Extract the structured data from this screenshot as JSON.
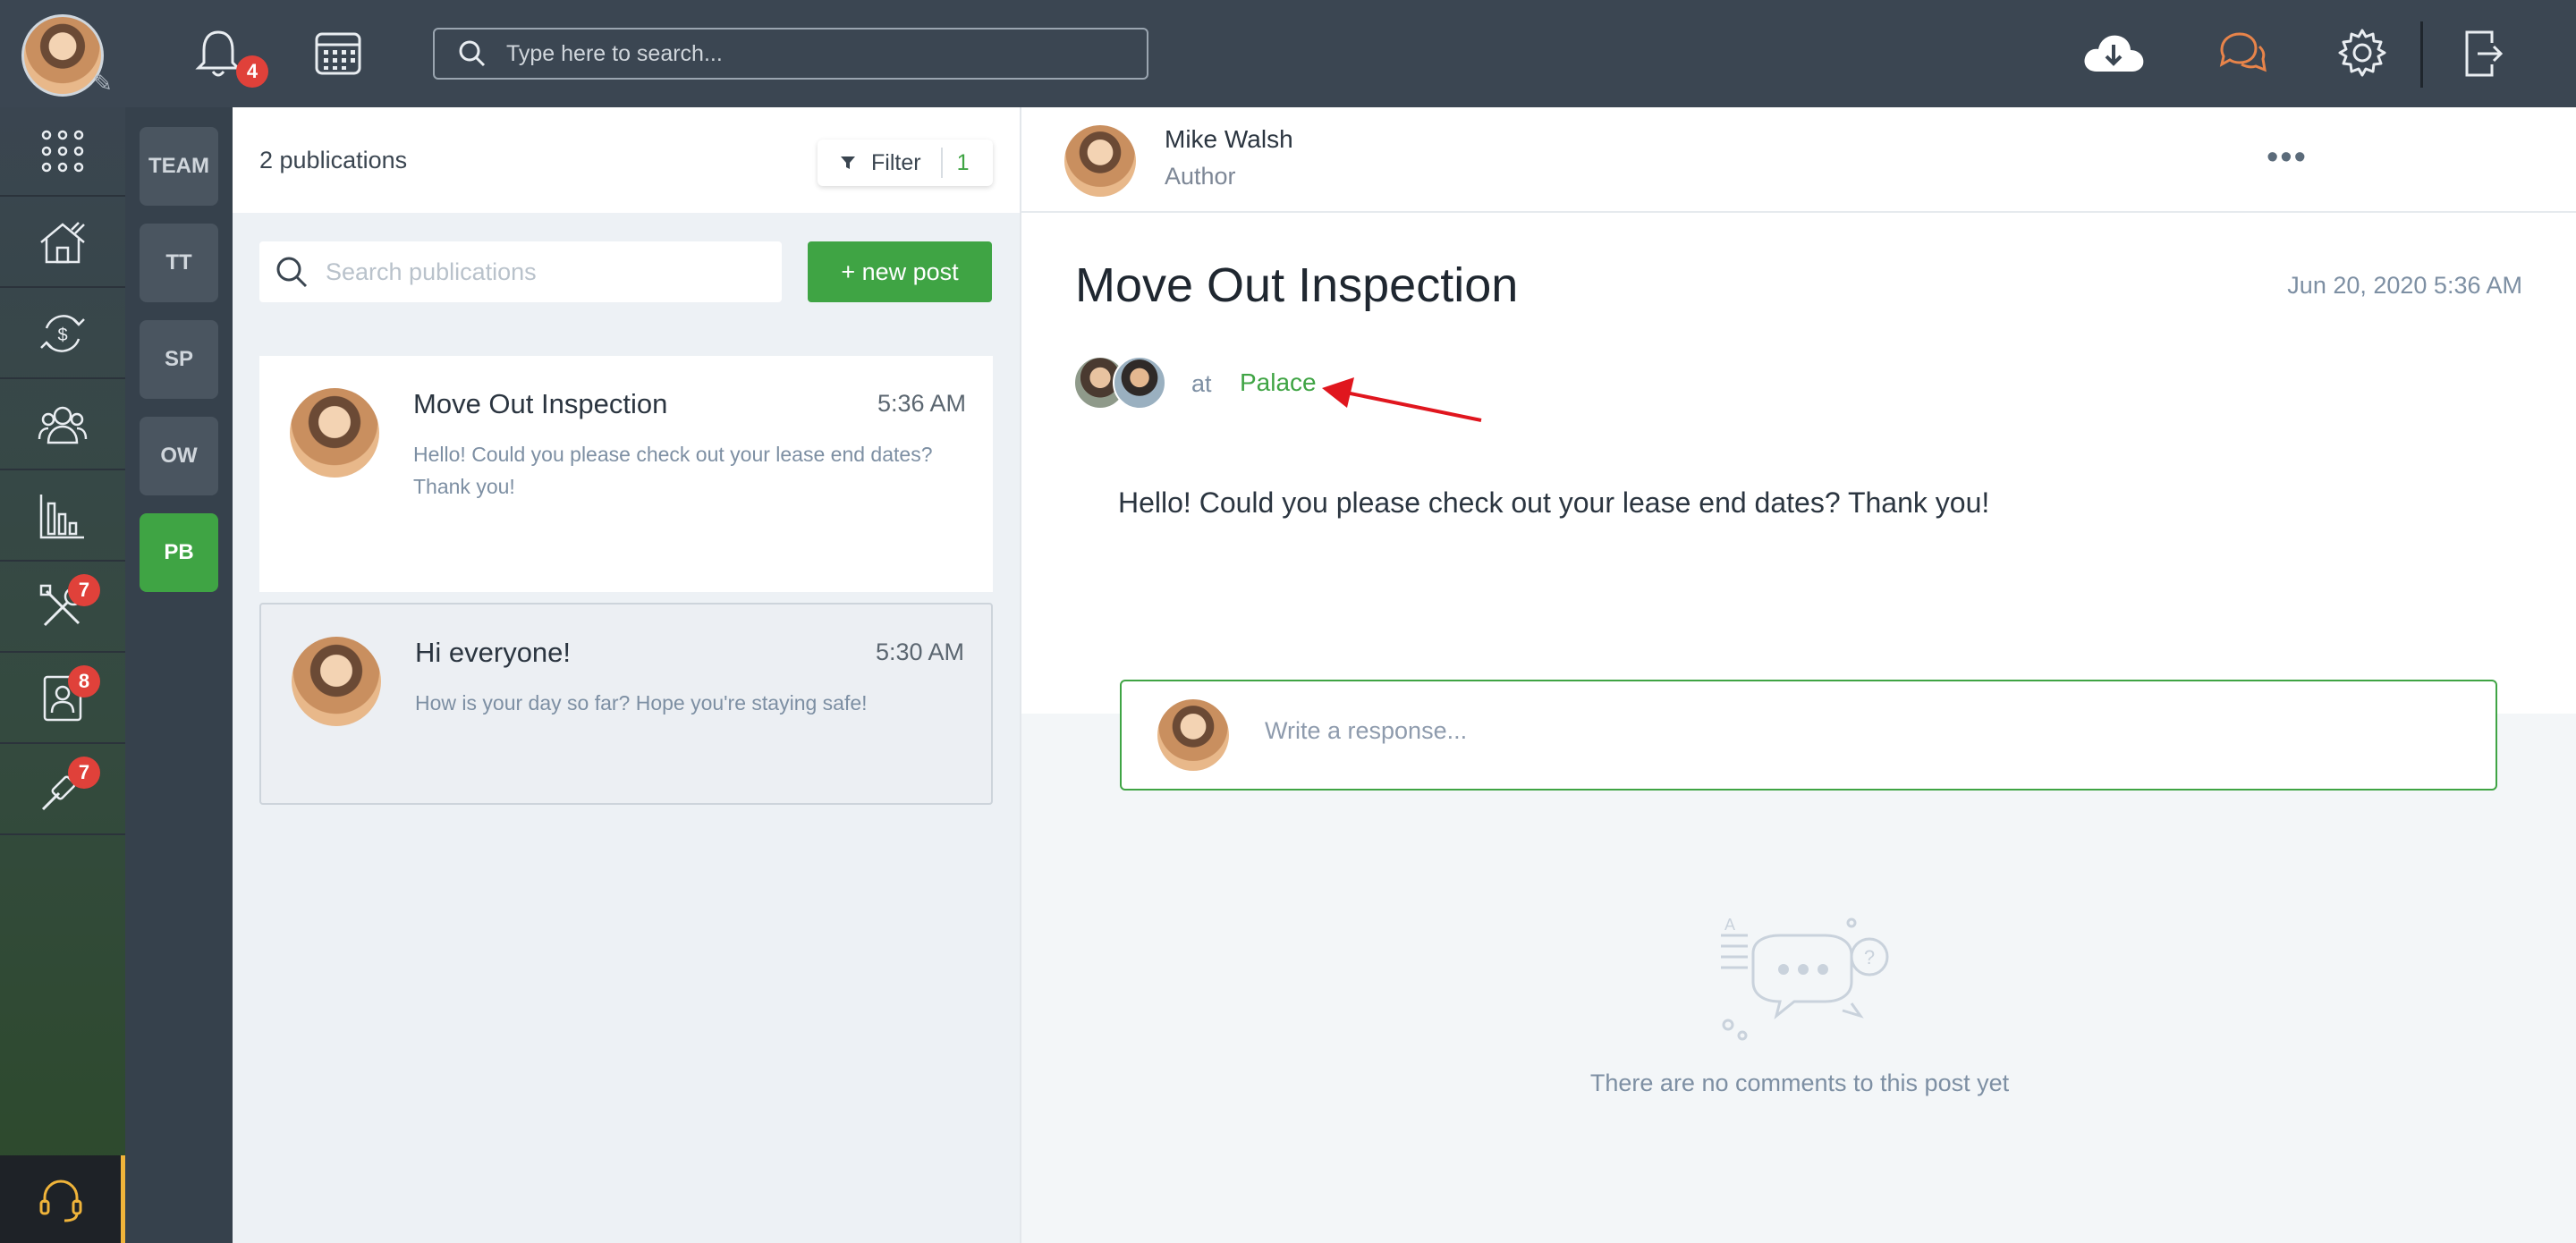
{
  "topbar": {
    "notifications_badge": "4",
    "search_placeholder": "Type here to search...",
    "icons": [
      "bell-icon",
      "calendar-icon",
      "search-icon",
      "cloud-download-icon",
      "chat-icon",
      "gear-icon",
      "logout-icon"
    ],
    "chat_icon_color": "#e8844a"
  },
  "rail": {
    "items": [
      {
        "name": "apps-grid-icon"
      },
      {
        "name": "properties-icon"
      },
      {
        "name": "accounting-icon"
      },
      {
        "name": "people-icon"
      },
      {
        "name": "reports-icon"
      },
      {
        "name": "maintenance-icon",
        "badge": "7"
      },
      {
        "name": "tenant-icon",
        "badge": "8"
      },
      {
        "name": "tools-icon",
        "badge": "7"
      }
    ],
    "bottom": "headset-icon"
  },
  "teams": [
    "TEAM",
    "TT",
    "SP",
    "OW",
    "PB"
  ],
  "active_team": "PB",
  "publications": {
    "count_label": "2 publications",
    "filter_label": "Filter",
    "filter_count": "1",
    "search_placeholder": "Search publications",
    "new_post_label": "+ new post",
    "items": [
      {
        "title": "Move Out Inspection",
        "time": "5:36 AM",
        "body": "Hello! Could you please check out your lease end dates? Thank you!"
      },
      {
        "title": "Hi everyone!",
        "time": "5:30 AM",
        "body": "How is your day so far? Hope you're staying safe!"
      }
    ]
  },
  "post": {
    "author_name": "Mike Walsh",
    "author_role": "Author",
    "title": "Move Out Inspection",
    "date": "Jun 20, 2020 5:36 AM",
    "at_label": "at",
    "location": "Palace",
    "body": "Hello! Could you please check out your lease end dates? Thank you!",
    "response_placeholder": "Write a response...",
    "empty_comments": "There are no comments to this post yet"
  },
  "colors": {
    "accent_green": "#3fa444",
    "topbar": "#3b4652",
    "badge_red": "#e0413a",
    "annotation_arrow": "#e0161e"
  }
}
